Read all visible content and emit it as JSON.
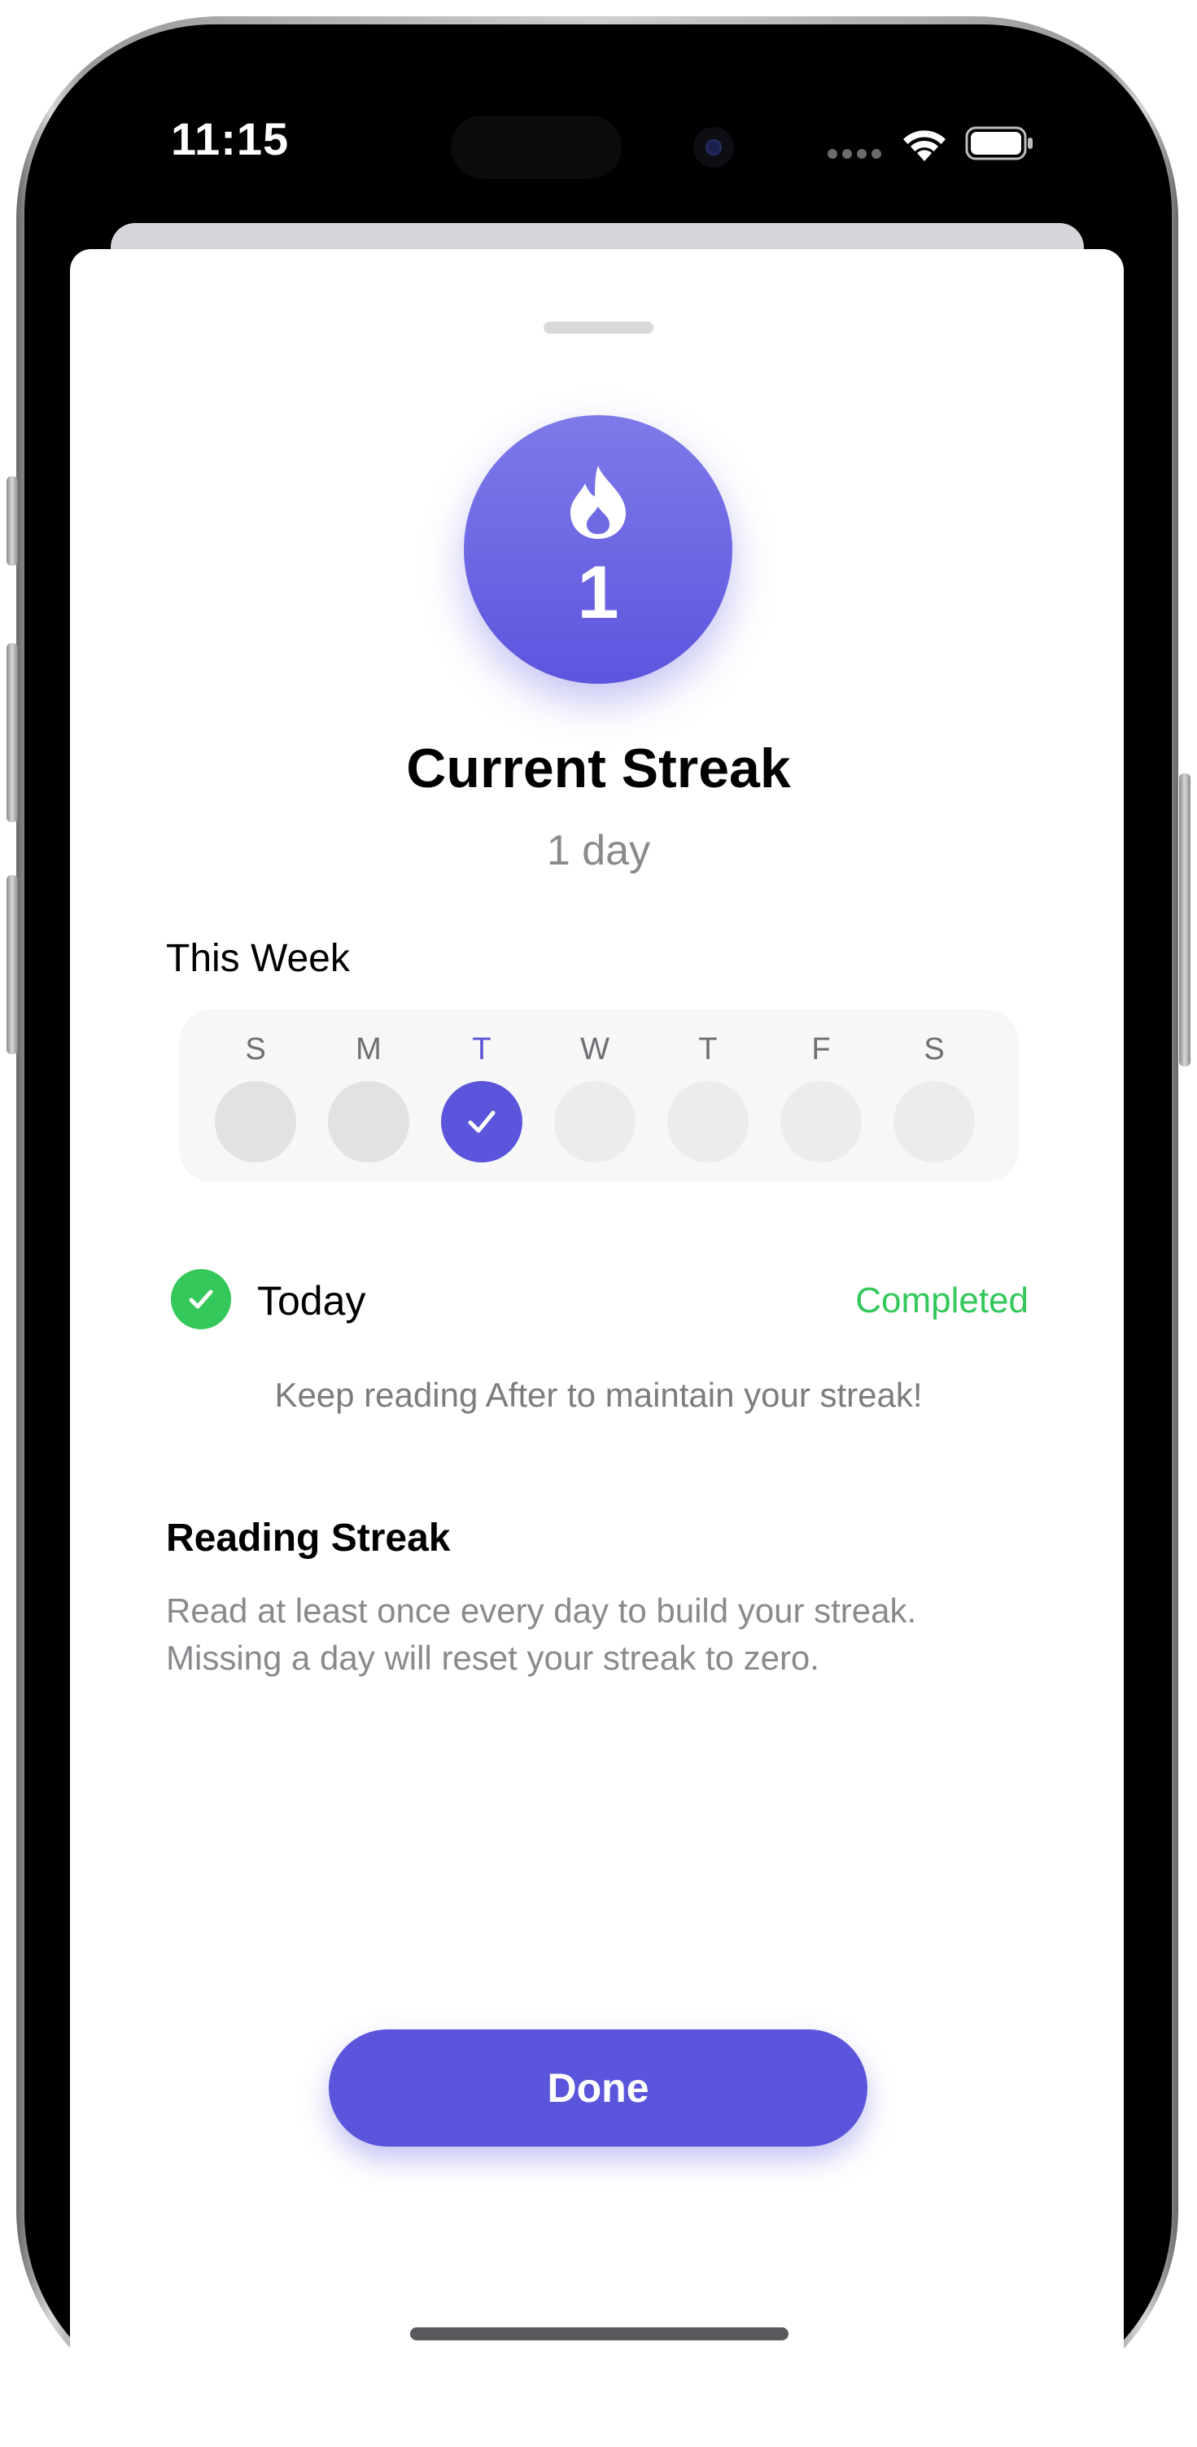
{
  "status_bar": {
    "time": "11:15",
    "wifi_icon": "wifi-icon",
    "battery_icon": "battery-icon"
  },
  "streak": {
    "count": "1",
    "icon": "flame-icon",
    "title": "Current Streak",
    "subtitle": "1 day"
  },
  "week": {
    "label": "This Week",
    "days": [
      {
        "letter": "S",
        "state": "past"
      },
      {
        "letter": "M",
        "state": "past"
      },
      {
        "letter": "T",
        "state": "done"
      },
      {
        "letter": "W",
        "state": "future"
      },
      {
        "letter": "T",
        "state": "future"
      },
      {
        "letter": "F",
        "state": "future"
      },
      {
        "letter": "S",
        "state": "future"
      }
    ]
  },
  "today": {
    "label": "Today",
    "status": "Completed"
  },
  "encouragement": "Keep reading After to maintain your streak!",
  "info": {
    "title": "Reading Streak",
    "line1": "Read at least once every day to build your streak.",
    "line2": "Missing a day will reset your streak to zero."
  },
  "done_button": {
    "label": "Done"
  },
  "colors": {
    "accent": "#5A55DB",
    "success": "#34C759",
    "secondary_text": "#8A8A8E"
  }
}
